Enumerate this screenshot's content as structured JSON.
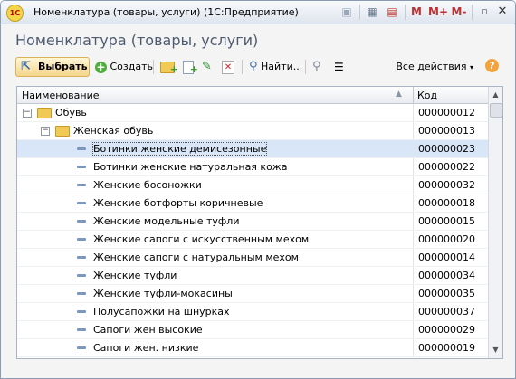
{
  "window": {
    "title": "Номенклатура (товары, услуги)  (1С:Предприятие)",
    "logo_text": "1С",
    "title_buttons": [
      "M",
      "M+",
      "M-"
    ]
  },
  "form": {
    "title": "Номенклатура (товары, услуги)"
  },
  "toolbar": {
    "select_label": "Выбрать",
    "create_label": "Создать",
    "find_label": "Найти...",
    "all_actions_label": "Все действия",
    "help_label": "?"
  },
  "table": {
    "columns": [
      "Наименование",
      "Код"
    ],
    "rows": [
      {
        "name": "Обувь",
        "code": "000000012",
        "kind": "group",
        "level": 0,
        "selected": false
      },
      {
        "name": "Женская обувь",
        "code": "000000013",
        "kind": "group",
        "level": 1,
        "selected": false
      },
      {
        "name": "Ботинки женские демисезонные",
        "code": "000000023",
        "kind": "item",
        "level": 2,
        "selected": true
      },
      {
        "name": "Ботинки женские натуральная кожа",
        "code": "000000022",
        "kind": "item",
        "level": 2,
        "selected": false
      },
      {
        "name": "Женские босоножки",
        "code": "000000032",
        "kind": "item",
        "level": 2,
        "selected": false
      },
      {
        "name": "Женские ботфорты коричневые",
        "code": "000000018",
        "kind": "item",
        "level": 2,
        "selected": false
      },
      {
        "name": "Женские модельные туфли",
        "code": "000000015",
        "kind": "item",
        "level": 2,
        "selected": false
      },
      {
        "name": "Женские сапоги с искусственным мехом",
        "code": "000000020",
        "kind": "item",
        "level": 2,
        "selected": false
      },
      {
        "name": "Женские сапоги с натуральным мехом",
        "code": "000000014",
        "kind": "item",
        "level": 2,
        "selected": false
      },
      {
        "name": "Женские туфли",
        "code": "000000034",
        "kind": "item",
        "level": 2,
        "selected": false
      },
      {
        "name": "Женские туфли-мокасины",
        "code": "000000035",
        "kind": "item",
        "level": 2,
        "selected": false
      },
      {
        "name": "Полусапожки на шнурках",
        "code": "000000037",
        "kind": "item",
        "level": 2,
        "selected": false
      },
      {
        "name": "Сапоги жен высокие",
        "code": "000000029",
        "kind": "item",
        "level": 2,
        "selected": false
      },
      {
        "name": "Сапоги жен. низкие",
        "code": "000000019",
        "kind": "item",
        "level": 2,
        "selected": false
      }
    ]
  }
}
